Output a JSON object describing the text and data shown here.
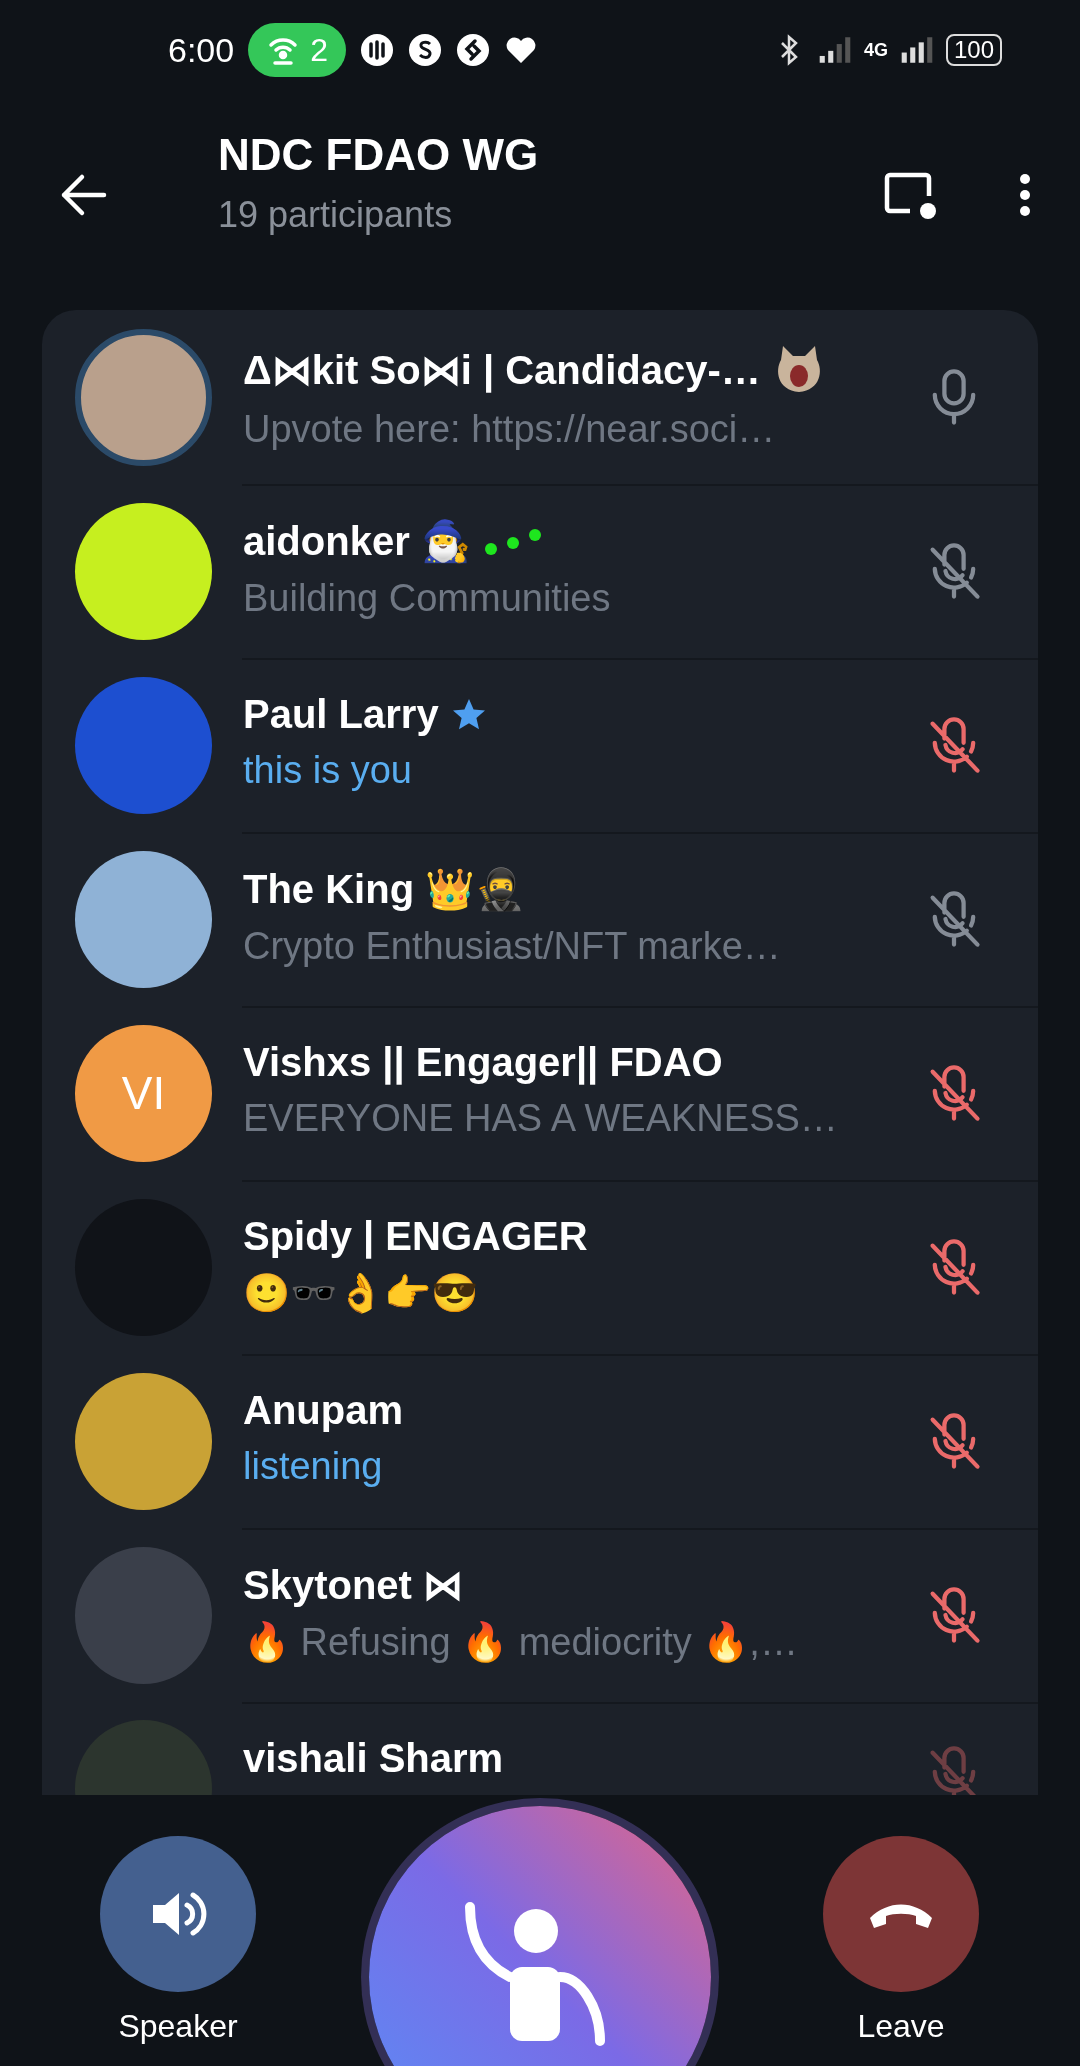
{
  "status_bar": {
    "time": "6:00",
    "hotspot_count": "2",
    "network": "4G",
    "battery": "100"
  },
  "header": {
    "title": "NDC FDAO WG",
    "subtitle": "19 participants"
  },
  "participants": [
    {
      "name": "Δ⋈kit So⋈i | Candidacy-…",
      "about": "Upvote here: https://near.soci…",
      "highlighted": false,
      "muted": false,
      "can_speak": true,
      "avatar": {
        "kind": "photo",
        "color": "#b9a08c"
      },
      "sticker": true
    },
    {
      "name": "aidonker 🧙‍♂️",
      "about": "Building Communities",
      "highlighted": false,
      "muted": true,
      "can_speak": true,
      "avatar": {
        "kind": "photo",
        "color": "#c6ef1f"
      },
      "speaking_dots": true
    },
    {
      "name": "Paul Larry",
      "about": "this is you",
      "highlighted": true,
      "muted": true,
      "can_speak": false,
      "avatar": {
        "kind": "photo",
        "color": "#1d4fd0"
      },
      "premium": true
    },
    {
      "name": "The King 👑🥷",
      "about": "Crypto Enthusiast/NFT marke…",
      "highlighted": false,
      "muted": true,
      "can_speak": true,
      "avatar": {
        "kind": "photo",
        "color": "#8fb2d6"
      }
    },
    {
      "name": "Vishxs || Engager|| FDAO",
      "about": "EVERYONE HAS A WEAKNESS…",
      "highlighted": false,
      "muted": true,
      "can_speak": false,
      "avatar": {
        "kind": "initials",
        "initials": "VI",
        "color": "#f09a45"
      }
    },
    {
      "name": "Spidy | ENGAGER",
      "about": "🙂🕶️👌👉😎",
      "highlighted": false,
      "muted": true,
      "can_speak": false,
      "avatar": {
        "kind": "photo",
        "color": "#101318"
      }
    },
    {
      "name": "Anupam",
      "about": "listening",
      "highlighted": true,
      "muted": true,
      "can_speak": false,
      "avatar": {
        "kind": "photo",
        "color": "#c9a235"
      }
    },
    {
      "name": "Skytonet ⋈",
      "about": "🔥 Refusing 🔥 mediocrity 🔥,…",
      "highlighted": false,
      "muted": true,
      "can_speak": false,
      "avatar": {
        "kind": "photo",
        "color": "#3a3f4a"
      }
    },
    {
      "name": "vishali Sharm",
      "muted": true,
      "can_speak": false,
      "avatar": {
        "kind": "photo",
        "color": "#2c352e"
      }
    }
  ],
  "controls": {
    "speaker": "Speaker",
    "leave": "Leave"
  }
}
